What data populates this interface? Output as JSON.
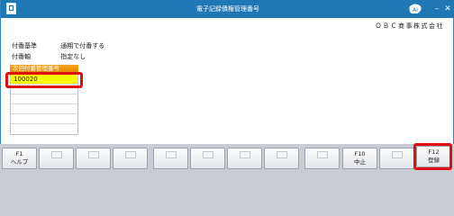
{
  "window": {
    "title": "電子記録債権管理番号",
    "company": "ＯＢＣ商事株式会社"
  },
  "info": [
    {
      "key": "付番基準",
      "value": "通期で付番する"
    },
    {
      "key": "付番軸",
      "value": "指定なし"
    }
  ],
  "number_section": {
    "header": "次回付番管理番号",
    "rows": [
      "100020",
      "",
      "",
      "",
      "",
      ""
    ],
    "selected_index": 0
  },
  "function_keys": [
    {
      "key": "F1",
      "label": "ヘルプ"
    },
    {
      "key": "",
      "label": ""
    },
    {
      "key": "",
      "label": ""
    },
    {
      "key": "",
      "label": ""
    },
    {
      "key": "",
      "label": ""
    },
    {
      "key": "",
      "label": ""
    },
    {
      "key": "",
      "label": ""
    },
    {
      "key": "",
      "label": ""
    },
    {
      "key": "",
      "label": ""
    },
    {
      "key": "F10",
      "label": "中止"
    },
    {
      "key": "",
      "label": ""
    },
    {
      "key": "F12",
      "label": "登録"
    }
  ],
  "colors": {
    "titlebar": "#1f77b4",
    "section_header": "#f39c12",
    "selected_row": "#ffff00",
    "annotation": "#e01010"
  }
}
